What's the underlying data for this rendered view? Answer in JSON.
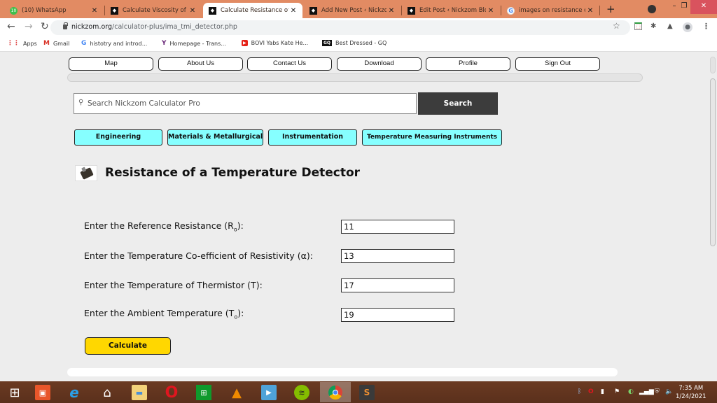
{
  "browser": {
    "tabs": [
      {
        "title": "(10) WhatsApp",
        "favicon": "whatsapp-icon",
        "active": false
      },
      {
        "title": "Calculate Viscosity of N",
        "favicon": "nickzom-icon",
        "active": false
      },
      {
        "title": "Calculate Resistance of",
        "favicon": "nickzom-icon",
        "active": true
      },
      {
        "title": "Add New Post ‹ Nickzo",
        "favicon": "nickzom-icon",
        "active": false
      },
      {
        "title": "Edit Post ‹ Nickzom Blo",
        "favicon": "nickzom-icon",
        "active": false
      },
      {
        "title": "images on resistance c",
        "favicon": "google-icon",
        "active": false
      }
    ],
    "new_tab_label": "+",
    "window_controls": {
      "minimize": "–",
      "restore": "❐",
      "close": "✕"
    },
    "url": {
      "host": "nickzom.org",
      "path": "/calculator-plus/ima_tmi_detector.php"
    },
    "bookmarks": [
      {
        "label": "Apps",
        "icon": "apps-grid-icon"
      },
      {
        "label": "Gmail",
        "icon": "gmail-icon"
      },
      {
        "label": "histotry and introd...",
        "icon": "google-icon"
      },
      {
        "label": "Homepage - Trans...",
        "icon": "homepage-icon"
      },
      {
        "label": "BOVI Yabs Kate He...",
        "icon": "youtube-icon"
      },
      {
        "label": "Best Dressed - GQ",
        "icon": "gq-icon"
      }
    ]
  },
  "site": {
    "top_nav": [
      "Map",
      "About Us",
      "Contact Us",
      "Download",
      "Profile",
      "Sign Out"
    ],
    "search": {
      "placeholder": "Search Nickzom Calculator Pro",
      "button_label": "Search"
    },
    "categories": [
      "Engineering",
      "Materials & Metallurgical",
      "Instrumentation",
      "Temperature Measuring Instruments"
    ],
    "page_title": "Resistance of a Temperature Detector",
    "fields": [
      {
        "label": "Enter the Reference Resistance (R",
        "sub": "o",
        "suffix": "):",
        "value": "11"
      },
      {
        "label": "Enter the Temperature Co-efficient of Resistivity (α):",
        "sub": "",
        "suffix": "",
        "value": "13"
      },
      {
        "label": "Enter the Temperature of Thermistor (T):",
        "sub": "",
        "suffix": "",
        "value": "17"
      },
      {
        "label": "Enter the Ambient Temperature (T",
        "sub": "o",
        "suffix": "):",
        "value": "19"
      }
    ],
    "calculate_label": "Calculate",
    "colors": {
      "category_bg": "#86ffff",
      "calculate_bg": "#ffd700",
      "search_btn_bg": "#3c3c3c",
      "tabstrip": "#e28b63"
    }
  },
  "taskbar": {
    "apps": [
      "windows-start-icon",
      "photos-icon",
      "internet-explorer-icon",
      "home-icon",
      "file-explorer-icon",
      "opera-icon",
      "store-icon",
      "vlc-icon",
      "media-player-icon",
      "spotify-icon",
      "chrome-icon",
      "sublime-text-icon"
    ],
    "clock": {
      "time": "7:35 AM",
      "date": "1/24/2021"
    }
  }
}
